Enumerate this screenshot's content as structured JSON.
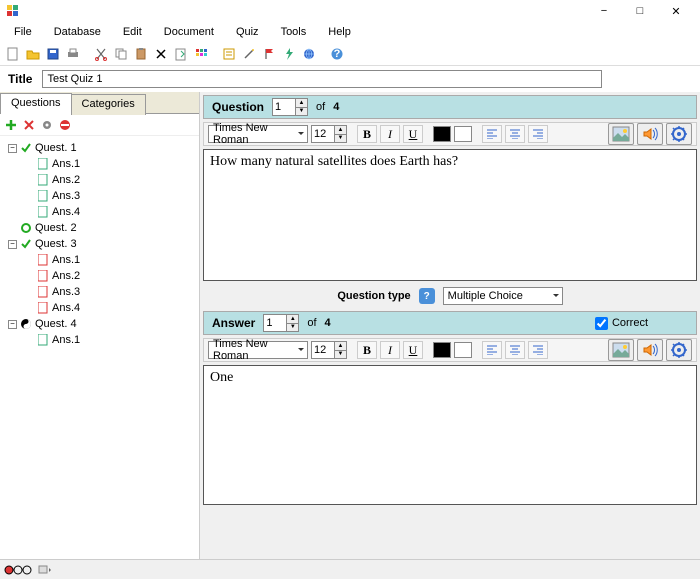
{
  "window": {
    "min": "−",
    "max": "□",
    "close": "✕"
  },
  "menu": [
    "File",
    "Database",
    "Edit",
    "Document",
    "Quiz",
    "Tools",
    "Help"
  ],
  "titleRow": {
    "label": "Title",
    "value": "Test Quiz 1"
  },
  "tabs": {
    "questions": "Questions",
    "categories": "Categories"
  },
  "tree": {
    "q1": "Quest. 1",
    "q2": "Quest. 2",
    "q3": "Quest. 3",
    "q4": "Quest. 4",
    "a1": "Ans.1",
    "a2": "Ans.2",
    "a3": "Ans.3",
    "a4": "Ans.4"
  },
  "question": {
    "header": "Question",
    "num": "1",
    "of": "of",
    "total": "4",
    "font": "Times New Roman",
    "size": "12",
    "text": "How many natural satellites does Earth has?"
  },
  "qtype": {
    "label": "Question type",
    "value": "Multiple Choice"
  },
  "answer": {
    "header": "Answer",
    "num": "1",
    "of": "of",
    "total": "4",
    "correct": "Correct",
    "font": "Times New Roman",
    "size": "12",
    "text": "One"
  },
  "fmt": {
    "b": "B",
    "i": "I",
    "u": "U"
  },
  "colors": {
    "black": "#000000",
    "white": "#ffffff",
    "accent": "#b8e0e3"
  }
}
